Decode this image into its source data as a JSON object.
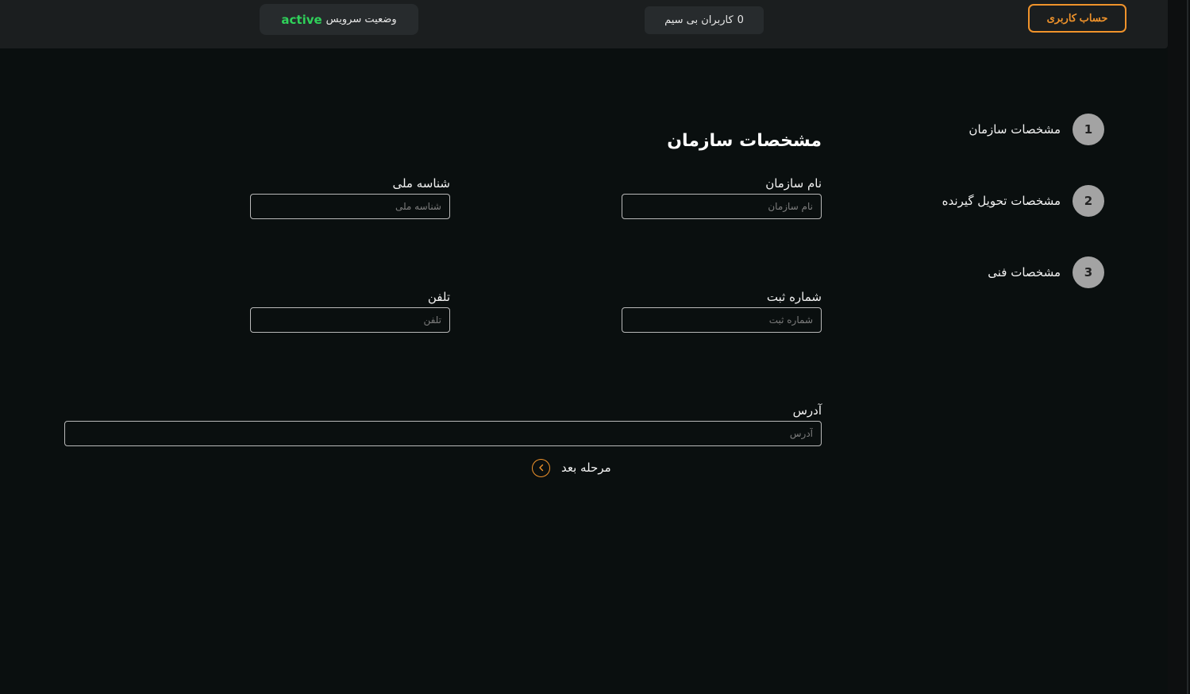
{
  "header": {
    "account_button": "حساب کاربری",
    "wireless_users": {
      "count": "0",
      "label": "کاربران بی سیم"
    },
    "service_status": {
      "label": "وضعیت سرویس",
      "value": "active",
      "value_color": "#2fd15a"
    }
  },
  "steps": [
    {
      "number": "1",
      "label": "مشخصات سازمان"
    },
    {
      "number": "2",
      "label": "مشخصات تحویل گیرنده"
    },
    {
      "number": "3",
      "label": "مشخصات فنی"
    }
  ],
  "form": {
    "title": "مشخصات سازمان",
    "org_name": {
      "label": "نام سازمان",
      "placeholder": "نام سازمان",
      "value": ""
    },
    "national_id": {
      "label": "شناسه ملی",
      "placeholder": "شناسه ملی",
      "value": ""
    },
    "reg_number": {
      "label": "شماره ثبت",
      "placeholder": "شماره ثبت",
      "value": ""
    },
    "phone": {
      "label": "تلفن",
      "placeholder": "تلفن",
      "value": ""
    },
    "address": {
      "label": "آدرس",
      "placeholder": "آدرس",
      "value": ""
    },
    "next_button": "مرحله بعد"
  },
  "icons": {
    "next": "chevron-left-icon"
  },
  "colors": {
    "accent": "#f0932b",
    "background": "#0a0f0f",
    "header": "#1b1e1f",
    "step_circle": "#a3a3a3"
  }
}
